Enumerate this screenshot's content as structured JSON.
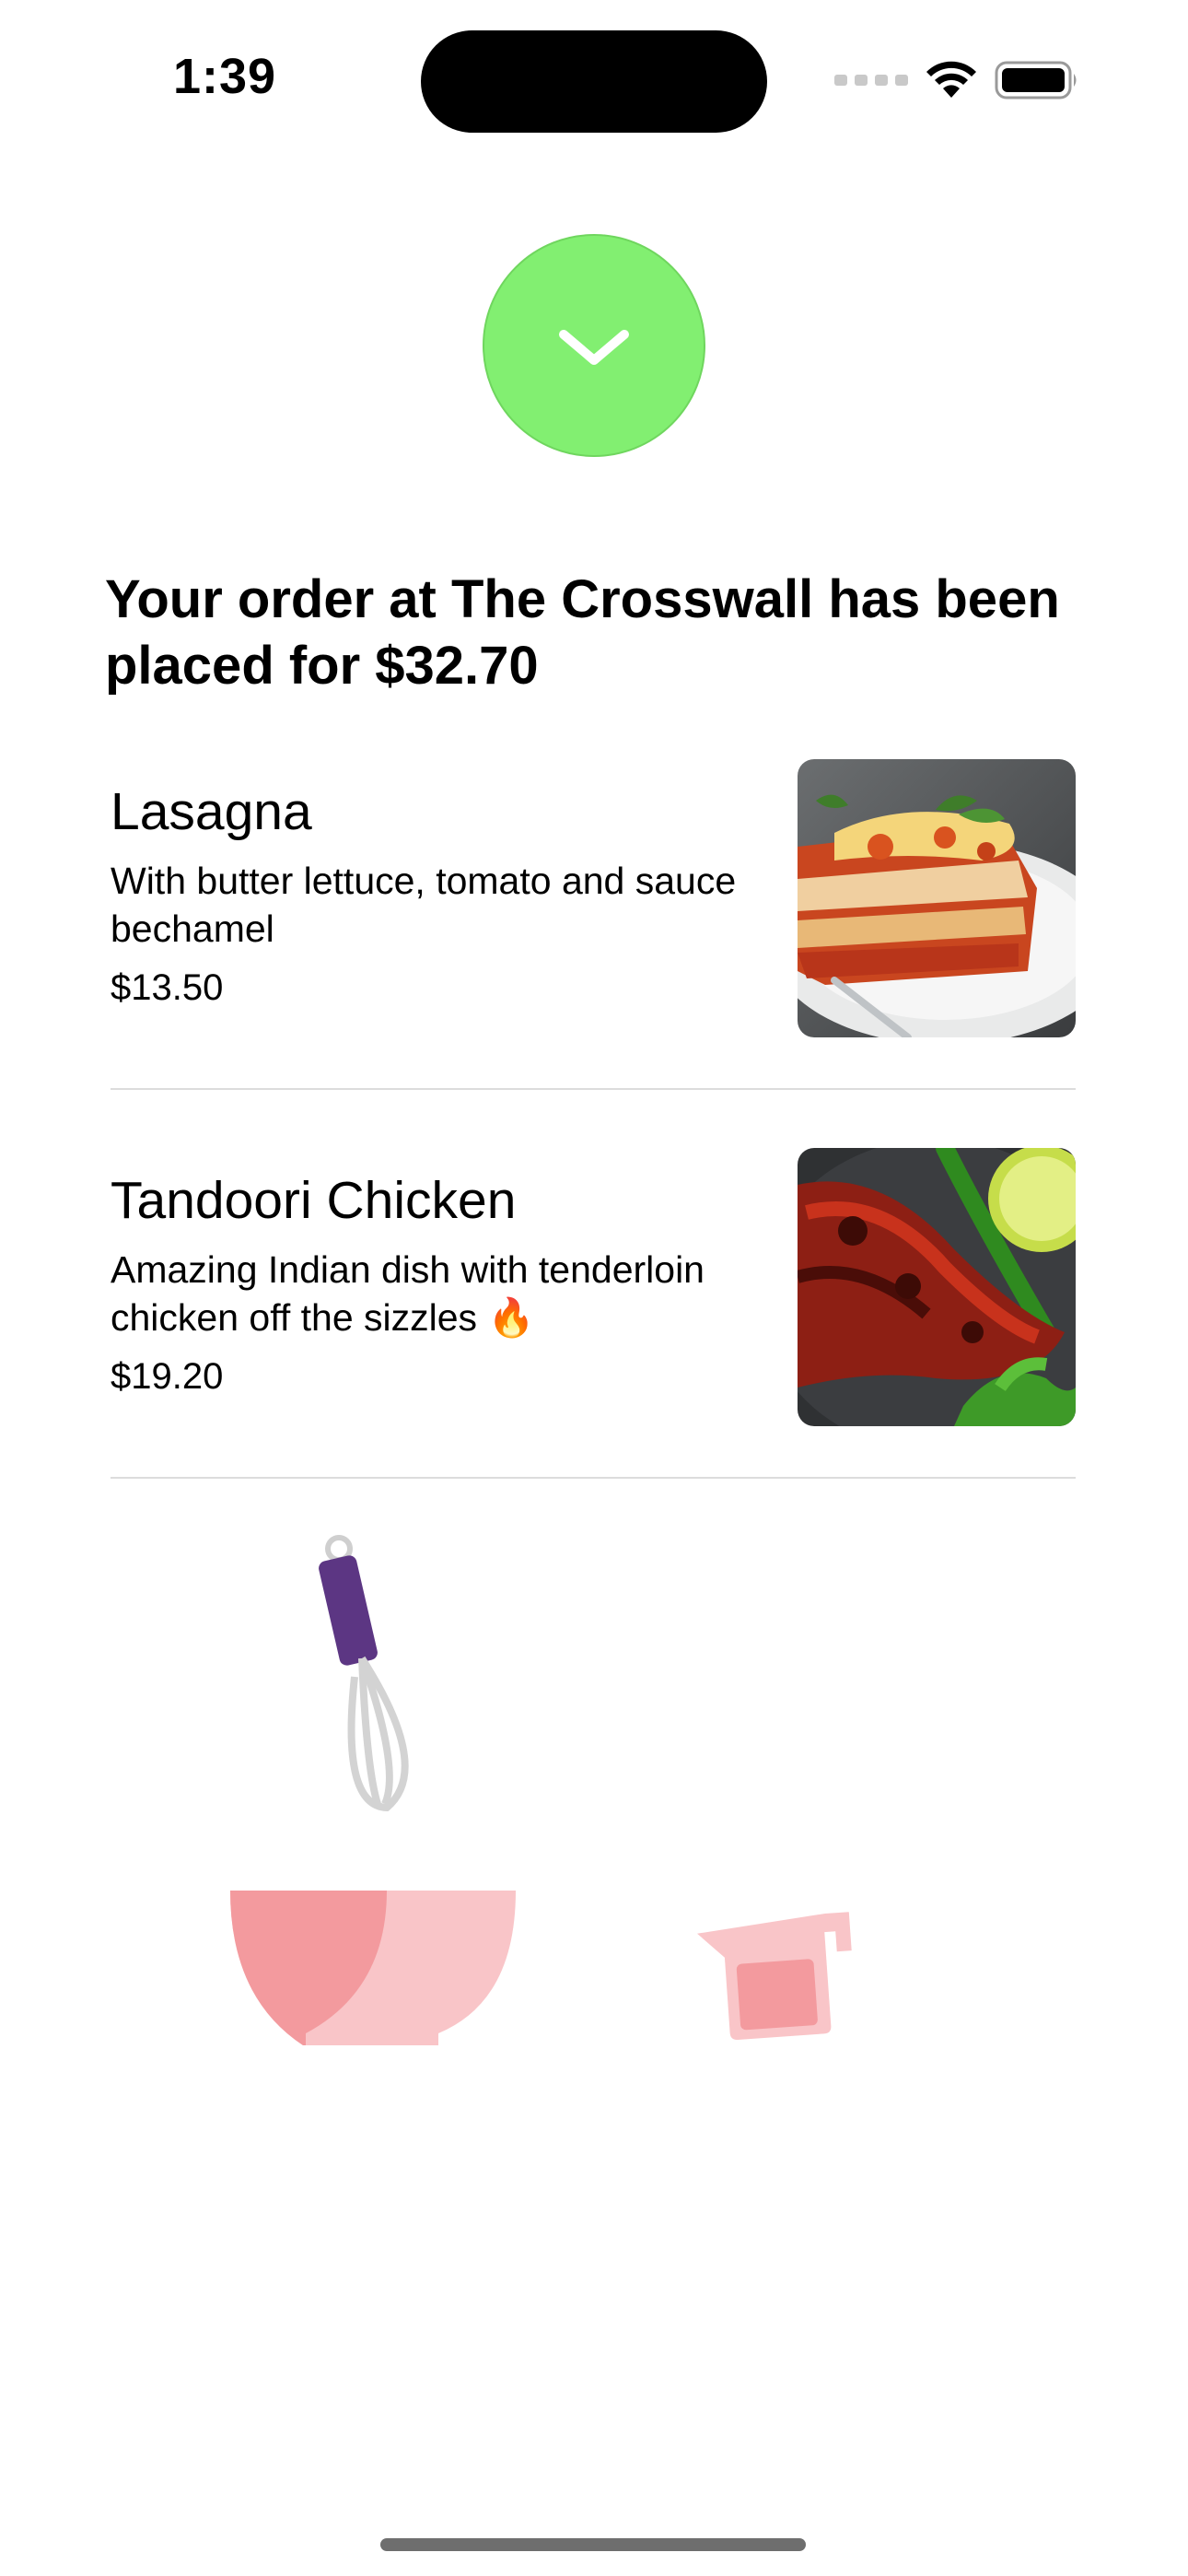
{
  "status_bar": {
    "time": "1:39"
  },
  "success_icon": "checkmark-icon",
  "confirmation": {
    "headline": "Your order at The Crosswall has been placed for $32.70"
  },
  "order_items": [
    {
      "name": "Lasagna",
      "description": "With butter lettuce, tomato and sauce bechamel",
      "price": "$13.50",
      "photo": "lasagna-photo"
    },
    {
      "name": "Tandoori Chicken",
      "description": "Amazing Indian dish with tenderloin chicken off the sizzles 🔥",
      "price": "$19.20",
      "photo": "tandoori-chicken-photo"
    }
  ],
  "illustration_icons": [
    "whisk-icon",
    "mixing-bowl-icon",
    "measuring-cup-icon"
  ],
  "colors": {
    "success_green": "#82ef71",
    "whisk_handle": "#5c3683",
    "bowl_pink": "#f9c5c8",
    "bowl_shadow": "#f39a9e"
  }
}
